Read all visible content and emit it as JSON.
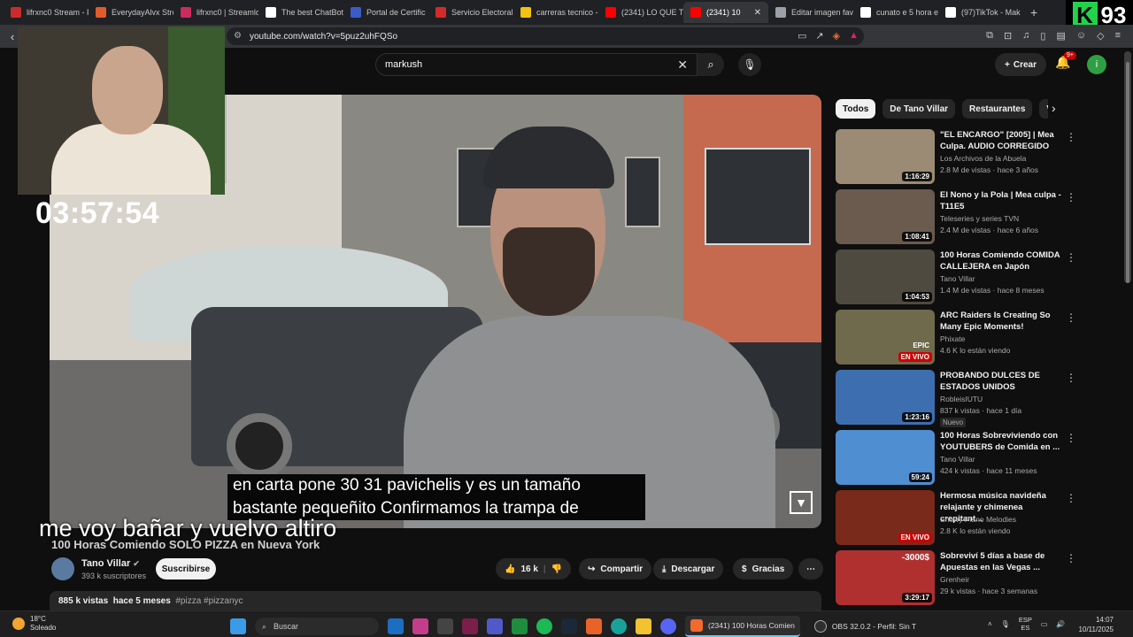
{
  "browser": {
    "tabs": [
      {
        "label": "lifrxnc0 Stream - P",
        "color": "#cc2b2b"
      },
      {
        "label": "EverydayAlvx Stre",
        "color": "#e25b2b"
      },
      {
        "label": "lifrxnc0 | Streamlo",
        "color": "#cc2b5e"
      },
      {
        "label": "The best ChatBot",
        "color": "#ffffff"
      },
      {
        "label": "Portal de Certific",
        "color": "#3a5cc9"
      },
      {
        "label": "Servicio Electoral",
        "color": "#d42a2a"
      },
      {
        "label": "carreras tecnico -",
        "color": "#f4c20d"
      },
      {
        "label": "(2341) LO QUE TI",
        "color": "#ff0000"
      },
      {
        "label": "(2341) 10",
        "color": "#ff0000"
      },
      {
        "label": "Editar imagen fav",
        "color": "#9aa0a6"
      },
      {
        "label": "cunato e 5 hora e",
        "color": "#ffffff"
      },
      {
        "label": "(97)TikTok - Mak",
        "color": "#ffffff"
      }
    ],
    "active_tab": 8,
    "new_tab": "+",
    "url": "youtube.com/watch?v=5puz2uhFQSo"
  },
  "overlay": {
    "score_letter": "K",
    "score_value": "93",
    "timer": "03:57:54",
    "stream_text": "me voy bañar y vuelvo altiro"
  },
  "header": {
    "search_value": "markush",
    "create_label": "Crear",
    "notifications_badge": "9+",
    "avatar_letter": "i"
  },
  "video": {
    "caption_line1": "en carta pone 30 31 pavichelis y es un tamaño",
    "caption_line2": "bastante pequeñito Confirmamos la trampa de",
    "title": "100 Horas Comiendo SOLO PIZZA en Nueva York",
    "channel": "Tano Villar",
    "subscribers": "393 k suscriptores",
    "subscribe_label": "Suscribirse",
    "likes": "16 k",
    "share_label": "Compartir",
    "download_label": "Descargar",
    "thanks_label": "Gracias",
    "views": "885 k vistas",
    "age": "hace 5 meses",
    "tags": "#pizza #pizzanyc"
  },
  "sidebar": {
    "chips": [
      "Todos",
      "De Tano Villar",
      "Restaurantes",
      "Videos"
    ],
    "recommendations": [
      {
        "title": "\"EL ENCARGO\" [2005] | Mea Culpa. AUDIO CORREGIDO",
        "channel": "Los Archivos de la Abuela",
        "meta": "2.8 M de vistas · hace 3 años",
        "duration": "1:16:29",
        "live": "",
        "badge": "",
        "thumb": "#9c8b74"
      },
      {
        "title": "El Nono y la Pola | Mea culpa - T11E5",
        "channel": "Teleseries y series TVN",
        "meta": "2.4 M de vistas · hace 6 años",
        "duration": "1:08:41",
        "live": "",
        "badge": "",
        "thumb": "#6b5a4e"
      },
      {
        "title": "100 Horas Comiendo COMIDA CALLEJERA en Japón",
        "channel": "Tano Villar",
        "meta": "1.4 M de vistas · hace 8 meses",
        "duration": "1:04:53",
        "live": "",
        "badge": "",
        "thumb": "#4f4a3f"
      },
      {
        "title": "ARC Raiders Is Creating So Many Epic Moments!",
        "channel": "Phixate",
        "meta": "4.6 K lo están viendo",
        "duration": "",
        "live": "EN VIVO",
        "badge": "",
        "thumb": "#6f6a4c"
      },
      {
        "title": "PROBANDO DULCES DE ESTADOS UNIDOS",
        "channel": "RobleisIUTU",
        "meta": "837 k vistas · hace 1 día",
        "duration": "1:23:16",
        "live": "",
        "badge": "Nuevo",
        "thumb": "#3d6fb0"
      },
      {
        "title": "100 Horas Sobreviviendo con YOUTUBERS de Comida en ...",
        "channel": "Tano Villar",
        "meta": "424 k vistas · hace 11 meses",
        "duration": "59:24",
        "live": "",
        "badge": "",
        "thumb": "#4f8ed0"
      },
      {
        "title": "Hermosa música navideña relajante y chimenea crepitant...",
        "channel": "Snowy Piano Melodies",
        "meta": "2.8 K lo están viendo",
        "duration": "",
        "live": "EN VIVO",
        "badge": "",
        "thumb": "#7a2a1a"
      },
      {
        "title": "Sobreviví 5 días a base de Apuestas en las Vegas ...",
        "channel": "Grenheir",
        "meta": "29 k vistas · hace 3 semanas",
        "duration": "3:29:17",
        "live": "",
        "badge": "",
        "thumb": "#b03030"
      }
    ],
    "thumb_labels": {
      "epic": "EPIC",
      "price": "-3000$"
    }
  },
  "taskbar": {
    "temperature": "18°C",
    "weather": "Soleado",
    "search_label": "Buscar",
    "app1": "(2341) 100 Horas Comien",
    "app2": "OBS 32.0.2 - Perfil: Sin T",
    "lang_top": "ESP",
    "lang_bottom": "ES",
    "time": "14:07",
    "date": "10/11/2025"
  }
}
